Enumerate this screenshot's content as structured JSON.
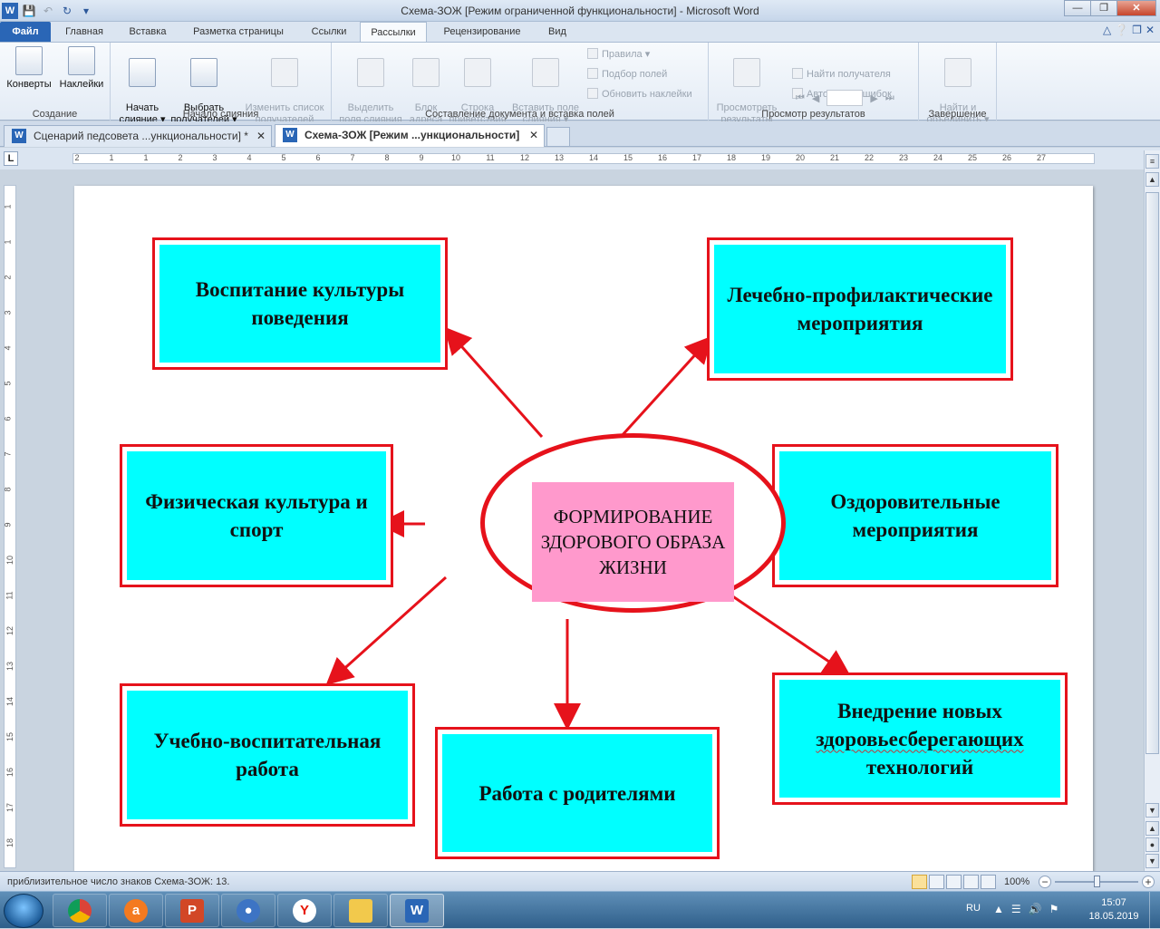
{
  "window": {
    "title": "Схема-ЗОЖ [Режим ограниченной функциональности]  -  Microsoft Word",
    "qat_icons": [
      "word-logo-icon",
      "save-icon",
      "undo-icon",
      "redo-icon",
      "customize-qat-icon"
    ]
  },
  "ribbon_tabs": [
    {
      "label": "Файл",
      "state": "file"
    },
    {
      "label": "Главная"
    },
    {
      "label": "Вставка"
    },
    {
      "label": "Разметка страницы"
    },
    {
      "label": "Ссылки"
    },
    {
      "label": "Рассылки",
      "state": "active"
    },
    {
      "label": "Рецензирование"
    },
    {
      "label": "Вид"
    }
  ],
  "ribbon": {
    "create": {
      "label": "Создание",
      "envelopes": "Конверты",
      "labels": "Наклейки"
    },
    "start_merge": {
      "label": "Начало слияния",
      "start": "Начать\nслияние ▾",
      "select": "Выбрать\nполучателей ▾",
      "edit": "Изменить список\nполучателей"
    },
    "write_insert": {
      "label": "Составление документа и вставка полей",
      "highlight": "Выделить\nполя слияния",
      "address": "Блок\nадреса",
      "greeting": "Строка\nприветствия",
      "insert_field": "Вставить поле\nслияния ▾",
      "rules": "Правила ▾",
      "match": "Подбор полей",
      "update": "Обновить наклейки"
    },
    "preview": {
      "label": "Просмотр результатов",
      "preview_btn": "Просмотреть\nрезультаты",
      "find": "Найти получателя",
      "auto_check": "Автопоиск ошибок"
    },
    "finish": {
      "label": "Завершение",
      "finish_btn": "Найти и\nобъединить ▾"
    }
  },
  "doc_tabs": [
    {
      "label": "Сценарий педсовета ...ункциональности]  *",
      "close": "✕"
    },
    {
      "label": "Схема-ЗОЖ [Режим ...ункциональности]",
      "close": "✕",
      "active": true
    }
  ],
  "ruler_h": [
    "2",
    "1",
    "1",
    "2",
    "3",
    "4",
    "5",
    "6",
    "7",
    "8",
    "9",
    "10",
    "11",
    "12",
    "13",
    "14",
    "15",
    "16",
    "17",
    "18",
    "19",
    "20",
    "21",
    "22",
    "23",
    "24",
    "25",
    "26",
    "27"
  ],
  "ruler_v": [
    "1",
    "1",
    "2",
    "3",
    "4",
    "5",
    "6",
    "7",
    "8",
    "9",
    "10",
    "11",
    "12",
    "13",
    "14",
    "15",
    "16",
    "17",
    "18"
  ],
  "diagram": {
    "center": "ФОРМИРОВАНИЕ ЗДОРОВОГО ОБРАЗА ЖИЗНИ",
    "blocks": {
      "behavior": "Воспитание культуры поведения",
      "medical": "Лечебно-профилактические мероприятия",
      "sport": "Физическая культура и спорт",
      "health": "Оздоровительные мероприятия",
      "education": "Учебно-воспитательная работа",
      "parents": "Работа с родителями",
      "tech_1": "Внедрение новых",
      "tech_2": "здоровьесберегающих",
      "tech_3": "технологий"
    },
    "colors": {
      "border": "#e6121b",
      "block_fill": "#00ffff",
      "center_fill": "#ff99cc"
    }
  },
  "status": {
    "text": "приблизительное число знаков Схема-ЗОЖ: 13.",
    "zoom": "100%"
  },
  "taskbar": {
    "apps": [
      "chrome-icon",
      "avast-icon",
      "powerpoint-icon",
      "keepass-icon",
      "yandex-browser-icon",
      "file-explorer-icon",
      "word-icon"
    ],
    "lang": "RU",
    "time": "15:07",
    "date": "18.05.2019"
  }
}
